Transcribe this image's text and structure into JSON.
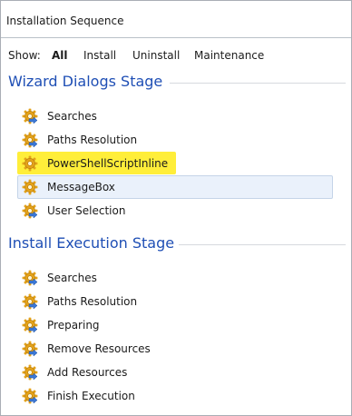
{
  "panel": {
    "title": "Installation Sequence"
  },
  "filters": {
    "show_label": "Show:",
    "options": [
      "All",
      "Install",
      "Uninstall",
      "Maintenance"
    ],
    "selected": "All"
  },
  "stages": [
    {
      "title": "Wizard Dialogs Stage",
      "items": [
        {
          "label": "Searches",
          "icon": "action-gear-arrow-icon"
        },
        {
          "label": "Paths Resolution",
          "icon": "action-gear-arrow-icon"
        },
        {
          "label": "PowerShellScriptInline",
          "icon": "action-gear-icon",
          "highlighted": true
        },
        {
          "label": "MessageBox",
          "icon": "action-gear-icon",
          "selected": true
        },
        {
          "label": "User Selection",
          "icon": "action-gear-arrow-icon"
        }
      ]
    },
    {
      "title": "Install Execution Stage",
      "items": [
        {
          "label": "Searches",
          "icon": "action-gear-arrow-icon"
        },
        {
          "label": "Paths Resolution",
          "icon": "action-gear-arrow-icon"
        },
        {
          "label": "Preparing",
          "icon": "action-gear-arrow-icon"
        },
        {
          "label": "Remove Resources",
          "icon": "action-gear-arrow-icon"
        },
        {
          "label": "Add Resources",
          "icon": "action-gear-arrow-icon"
        },
        {
          "label": "Finish Execution",
          "icon": "action-gear-arrow-icon"
        }
      ]
    }
  ],
  "colors": {
    "stage_title": "#1f4fb5",
    "highlight": "#ffee3a",
    "selected_bg": "#eaf1fb",
    "gear": "#e3a21a",
    "arrow": "#3b78d8"
  }
}
